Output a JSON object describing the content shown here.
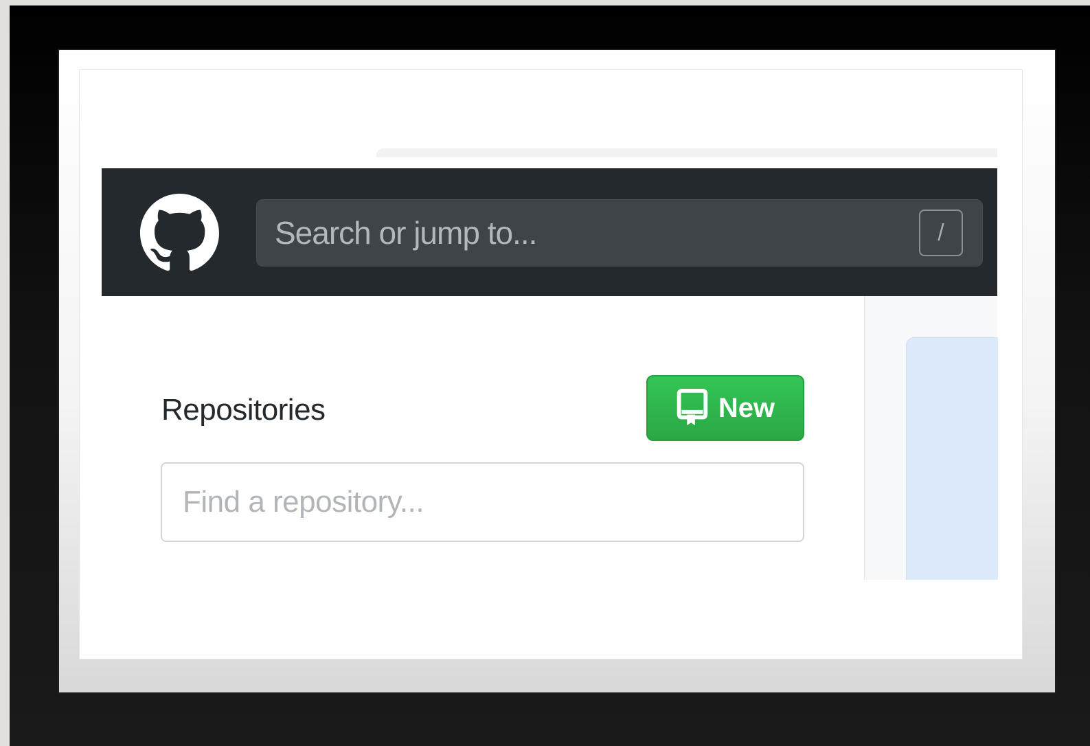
{
  "header": {
    "logo_icon": "github-octocat-icon",
    "search": {
      "value": "",
      "placeholder": "Search or jump to...",
      "shortcut_key": "/"
    },
    "background_color": "#24292e"
  },
  "sidebar": {
    "repositories_title": "Repositories",
    "new_button": {
      "label": "New",
      "icon": "repo-icon",
      "color": "#2ea44f"
    },
    "find_repository": {
      "value": "",
      "placeholder": "Find a repository..."
    }
  }
}
